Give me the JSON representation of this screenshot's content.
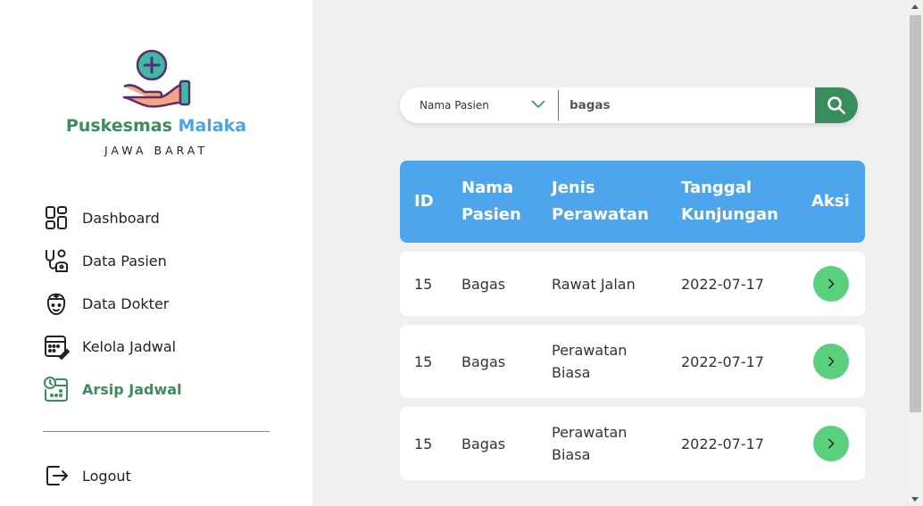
{
  "brand": {
    "name_part1": "Puskesmas",
    "name_part2": "Malaka",
    "region": "JAWA BARAT"
  },
  "colors": {
    "primary_green": "#3a8d5c",
    "accent_blue": "#4da6ec",
    "action_green": "#5ad07c"
  },
  "sidebar": {
    "items": [
      {
        "label": "Dashboard",
        "icon": "dashboard-icon",
        "active": false
      },
      {
        "label": "Data Pasien",
        "icon": "stethoscope-icon",
        "active": false
      },
      {
        "label": "Data Dokter",
        "icon": "doctor-icon",
        "active": false
      },
      {
        "label": "Kelola Jadwal",
        "icon": "calendar-edit-icon",
        "active": false
      },
      {
        "label": "Arsip Jadwal",
        "icon": "calendar-clock-icon",
        "active": true
      }
    ],
    "logout_label": "Logout"
  },
  "search": {
    "filter_selected": "Nama Pasien",
    "query": "bagas",
    "button_icon": "search-icon"
  },
  "table": {
    "headers": {
      "id": "ID",
      "nama_1": "Nama",
      "nama_2": "Pasien",
      "jenis_1": "Jenis",
      "jenis_2": "Perawatan",
      "tanggal_1": "Tanggal",
      "tanggal_2": "Kunjungan",
      "aksi": "Aksi"
    },
    "rows": [
      {
        "id": "15",
        "nama": "Bagas",
        "jenis_1": "Rawat Jalan",
        "jenis_2": "",
        "tanggal": "2022-07-17"
      },
      {
        "id": "15",
        "nama": "Bagas",
        "jenis_1": "Perawatan",
        "jenis_2": "Biasa",
        "tanggal": "2022-07-17"
      },
      {
        "id": "15",
        "nama": "Bagas",
        "jenis_1": "Perawatan",
        "jenis_2": "Biasa",
        "tanggal": "2022-07-17"
      }
    ]
  }
}
